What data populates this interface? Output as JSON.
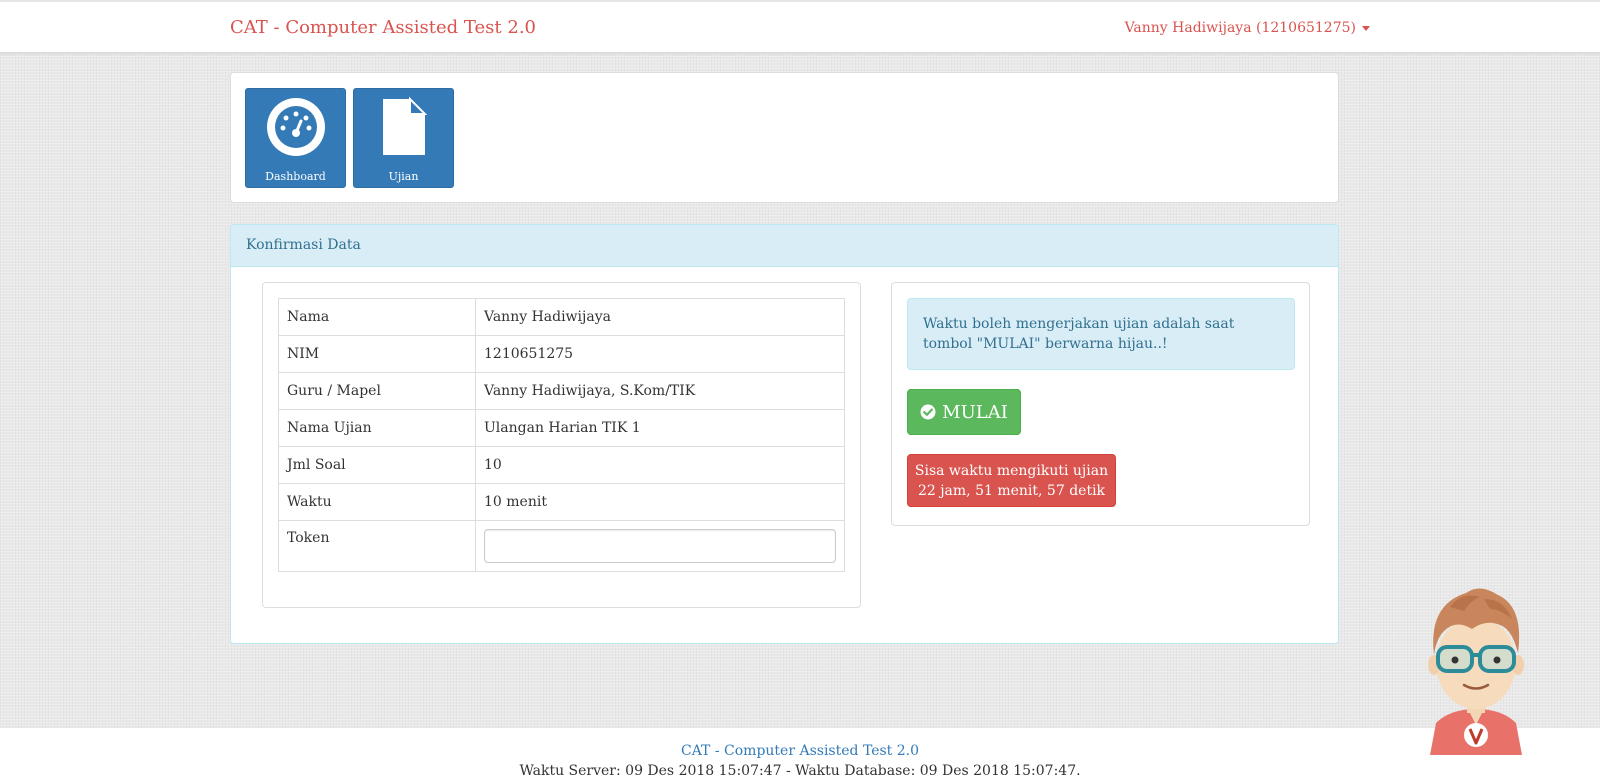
{
  "header": {
    "brand": "CAT - Computer Assisted Test 2.0",
    "user": "Vanny Hadiwijaya (1210651275)"
  },
  "menu": {
    "tiles": [
      {
        "label": "Dashboard",
        "icon": "dashboard-icon"
      },
      {
        "label": "Ujian",
        "icon": "file-icon"
      }
    ]
  },
  "confirm": {
    "heading": "Konfirmasi Data",
    "rows": [
      {
        "key": "Nama",
        "value": "Vanny Hadiwijaya"
      },
      {
        "key": "NIM",
        "value": "1210651275"
      },
      {
        "key": "Guru / Mapel",
        "value": "Vanny Hadiwijaya, S.Kom/TIK"
      },
      {
        "key": "Nama Ujian",
        "value": "Ulangan Harian TIK 1"
      },
      {
        "key": "Jml Soal",
        "value": "10"
      },
      {
        "key": "Waktu",
        "value": "10 menit"
      }
    ],
    "token_label": "Token",
    "token_value": ""
  },
  "side": {
    "info": "Waktu boleh mengerjakan ujian adalah saat tombol \"MULAI\" berwarna hijau..!",
    "start_label": "MULAI",
    "timer_line1": "Sisa waktu mengikuti ujian",
    "timer_line2": "22 jam, 51 menit, 57 detik"
  },
  "footer": {
    "title": "CAT - Computer Assisted Test 2.0",
    "time": "Waktu Server: 09 Des 2018 15:07:47 - Waktu Database: 09 Des 2018 15:07:47."
  },
  "colors": {
    "brand": "#d9534f",
    "primary": "#337ab7",
    "success": "#5cb85c",
    "danger": "#d9534f",
    "info_bg": "#d9edf7"
  }
}
